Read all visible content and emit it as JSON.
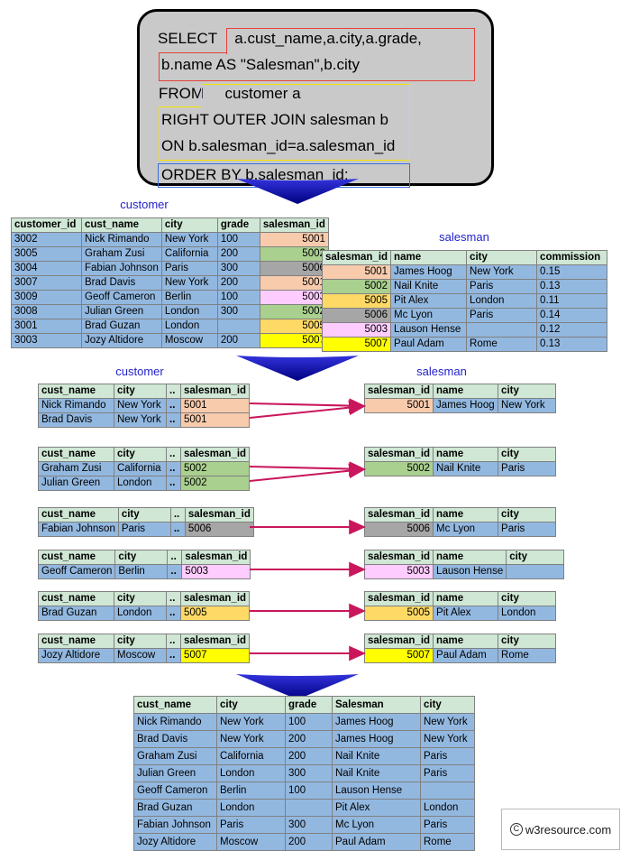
{
  "sql": {
    "line1_keyword": "SELECT",
    "line1_rest": "a.cust_name,a.city,a.grade,",
    "line2": "b.name AS \"Salesman\",b.city",
    "line3_keyword": "FROM",
    "line3_rest": "customer a",
    "line4": "RIGHT OUTER JOIN salesman b",
    "line5": "ON b.salesman_id=a.salesman_id",
    "line6": "ORDER BY b.salesman_id;"
  },
  "colors": {
    "select_outline": "#e8403a",
    "from_outline": "#f2e200",
    "order_outline": "#3b6ee0",
    "header_bg": "#cfe7d4",
    "cell_bg": "#92b8e0",
    "label": "#2222cc",
    "connector": "#c9165c",
    "arrow": "#1a1ab4",
    "k5001": "#f8cbad",
    "k5002": "#a9d08e",
    "k5003": "#ffccff",
    "k5005": "#ffd966",
    "k5006": "#a6a6a6",
    "k5007": "#ffff00"
  },
  "customer_label": "customer",
  "salesman_label": "salesman",
  "customer_table": {
    "columns": [
      "customer_id",
      "cust_name",
      "city",
      "grade",
      "salesman_id"
    ],
    "rows": [
      {
        "customer_id": "3002",
        "cust_name": "Nick Rimando",
        "city": "New York",
        "grade": "100",
        "salesman_id": "5001",
        "key": "5001"
      },
      {
        "customer_id": "3005",
        "cust_name": "Graham Zusi",
        "city": "California",
        "grade": "200",
        "salesman_id": "5002",
        "key": "5002"
      },
      {
        "customer_id": "3004",
        "cust_name": "Fabian Johnson",
        "city": "Paris",
        "grade": "300",
        "salesman_id": "5006",
        "key": "5006"
      },
      {
        "customer_id": "3007",
        "cust_name": "Brad Davis",
        "city": "New York",
        "grade": "200",
        "salesman_id": "5001",
        "key": "5001"
      },
      {
        "customer_id": "3009",
        "cust_name": "Geoff Cameron",
        "city": "Berlin",
        "grade": "100",
        "salesman_id": "5003",
        "key": "5003"
      },
      {
        "customer_id": "3008",
        "cust_name": "Julian Green",
        "city": "London",
        "grade": "300",
        "salesman_id": "5002",
        "key": "5002"
      },
      {
        "customer_id": "3001",
        "cust_name": "Brad Guzan",
        "city": "London",
        "grade": "",
        "salesman_id": "5005",
        "key": "5005"
      },
      {
        "customer_id": "3003",
        "cust_name": "Jozy Altidore",
        "city": "Moscow",
        "grade": "200",
        "salesman_id": "5007",
        "key": "5007"
      }
    ]
  },
  "salesman_table": {
    "columns": [
      "salesman_id",
      "name",
      "city",
      "commission"
    ],
    "rows": [
      {
        "salesman_id": "5001",
        "name": "James Hoog",
        "city": "New York",
        "commission": "0.15",
        "key": "5001"
      },
      {
        "salesman_id": "5002",
        "name": "Nail Knite",
        "city": "Paris",
        "commission": "0.13",
        "key": "5002"
      },
      {
        "salesman_id": "5005",
        "name": "Pit Alex",
        "city": "London",
        "commission": "0.11",
        "key": "5005"
      },
      {
        "salesman_id": "5006",
        "name": "Mc Lyon",
        "city": "Paris",
        "commission": "0.14",
        "key": "5006"
      },
      {
        "salesman_id": "5003",
        "name": "Lauson Hense",
        "city": "",
        "commission": "0.12",
        "key": "5003"
      },
      {
        "salesman_id": "5007",
        "name": "Paul Adam",
        "city": "Rome",
        "commission": "0.13",
        "key": "5007"
      }
    ]
  },
  "mid_customer_columns": [
    "cust_name",
    "city",
    "..",
    "salesman_id"
  ],
  "mid_salesman_columns": [
    "salesman_id",
    "name",
    "city"
  ],
  "groups": [
    {
      "key": "5001",
      "customer_rows": [
        {
          "cust_name": "Nick Rimando",
          "city": "New York",
          "dots": "..",
          "salesman_id": "5001"
        },
        {
          "cust_name": "Brad Davis",
          "city": "New York",
          "dots": "..",
          "salesman_id": "5001"
        }
      ],
      "salesman_rows": [
        {
          "salesman_id": "5001",
          "name": "James Hoog",
          "city": "New York"
        }
      ]
    },
    {
      "key": "5002",
      "customer_rows": [
        {
          "cust_name": "Graham Zusi",
          "city": "California",
          "dots": "..",
          "salesman_id": "5002"
        },
        {
          "cust_name": "Julian Green",
          "city": "London",
          "dots": "..",
          "salesman_id": "5002"
        }
      ],
      "salesman_rows": [
        {
          "salesman_id": "5002",
          "name": "Nail Knite",
          "city": "Paris"
        }
      ]
    },
    {
      "key": "5006",
      "customer_rows": [
        {
          "cust_name": "Fabian Johnson",
          "city": "Paris",
          "dots": "..",
          "salesman_id": "5006"
        }
      ],
      "salesman_rows": [
        {
          "salesman_id": "5006",
          "name": "Mc Lyon",
          "city": "Paris"
        }
      ]
    },
    {
      "key": "5003",
      "customer_rows": [
        {
          "cust_name": "Geoff Cameron",
          "city": "Berlin",
          "dots": "..",
          "salesman_id": "5003"
        }
      ],
      "salesman_rows": [
        {
          "salesman_id": "5003",
          "name": "Lauson Hense",
          "city": ""
        }
      ]
    },
    {
      "key": "5005",
      "customer_rows": [
        {
          "cust_name": "Brad Guzan",
          "city": "London",
          "dots": "..",
          "salesman_id": "5005"
        }
      ],
      "salesman_rows": [
        {
          "salesman_id": "5005",
          "name": "Pit Alex",
          "city": "London"
        }
      ]
    },
    {
      "key": "5007",
      "customer_rows": [
        {
          "cust_name": "Jozy Altidore",
          "city": "Moscow",
          "dots": "..",
          "salesman_id": "5007"
        }
      ],
      "salesman_rows": [
        {
          "salesman_id": "5007",
          "name": "Paul Adam",
          "city": "Rome"
        }
      ]
    }
  ],
  "result_table": {
    "columns": [
      "cust_name",
      "city",
      "grade",
      "Salesman",
      "city"
    ],
    "rows": [
      [
        "Nick Rimando",
        "New York",
        "100",
        "James Hoog",
        "New York"
      ],
      [
        "Brad Davis",
        "New York",
        "200",
        "James Hoog",
        "New York"
      ],
      [
        "Graham Zusi",
        "California",
        "200",
        "Nail Knite",
        "Paris"
      ],
      [
        "Julian Green",
        "London",
        "300",
        "Nail Knite",
        "Paris"
      ],
      [
        "Geoff Cameron",
        "Berlin",
        "100",
        "Lauson Hense",
        ""
      ],
      [
        "Brad Guzan",
        "London",
        "",
        "Pit Alex",
        "London"
      ],
      [
        "Fabian Johnson",
        "Paris",
        "300",
        "Mc Lyon",
        "Paris"
      ],
      [
        "Jozy Altidore",
        "Moscow",
        "200",
        "Paul Adam",
        "Rome"
      ]
    ]
  },
  "footer": {
    "copyright_mark": "C",
    "text": "w3resource.com"
  }
}
